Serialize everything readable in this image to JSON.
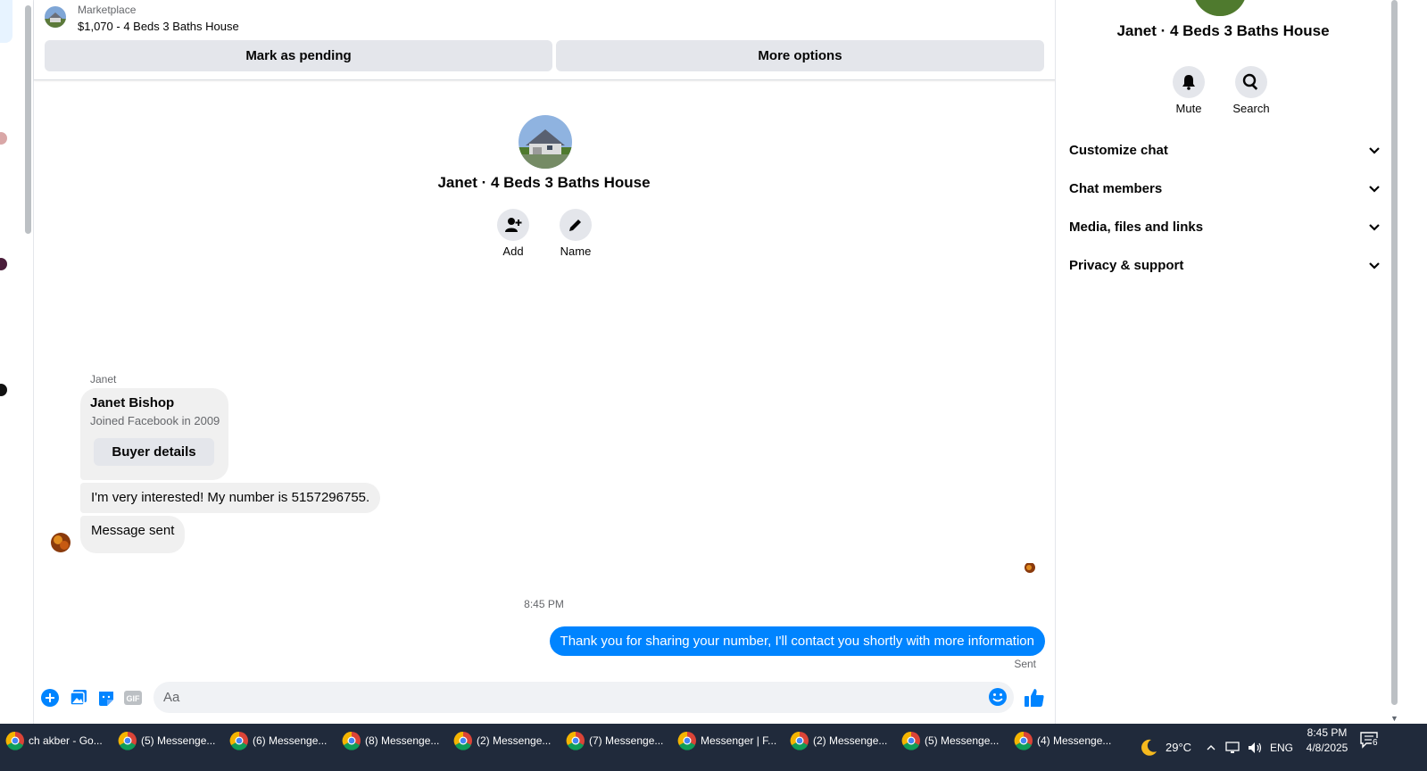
{
  "listing": {
    "source": "Marketplace",
    "title": "$1,070 - 4 Beds 3 Baths House",
    "mark_pending": "Mark as pending",
    "more_options": "More options"
  },
  "profile": {
    "name": "Janet · 4 Beds 3 Baths House",
    "add_label": "Add",
    "name_label": "Name"
  },
  "messages": {
    "sender": "Janet",
    "card_name": "Janet Bishop",
    "card_sub": "Joined Facebook in 2009",
    "card_button": "Buyer details",
    "msg_interest": "I'm very interested! My number is 5157296755.",
    "msg_sent_notice": "Message sent",
    "timestamp": "8:45 PM",
    "msg_out": "Thank you for sharing your number, I'll contact you shortly with more information",
    "status": "Sent"
  },
  "composer": {
    "placeholder": "Aa"
  },
  "info_panel": {
    "name": "Janet · 4 Beds 3 Baths House",
    "mute": "Mute",
    "search": "Search",
    "rows": [
      "Customize chat",
      "Chat members",
      "Media, files and links",
      "Privacy & support"
    ]
  },
  "taskbar": {
    "tasks": [
      "ch akber - Go...",
      "(5) Messenge...",
      "(6) Messenge...",
      "(8) Messenge...",
      "(2) Messenge...",
      "(7) Messenge...",
      "Messenger | F...",
      "(2) Messenge...",
      "(5) Messenge...",
      "(4) Messenge..."
    ],
    "weather": "29°C",
    "lang": "ENG",
    "time": "8:45 PM",
    "date": "4/8/2025",
    "notif_count": "6"
  },
  "colors": {
    "accent": "#0084ff",
    "bubble_in": "#f0f0f0",
    "button_gray": "#e4e6eb",
    "taskbar": "#202a3b"
  }
}
